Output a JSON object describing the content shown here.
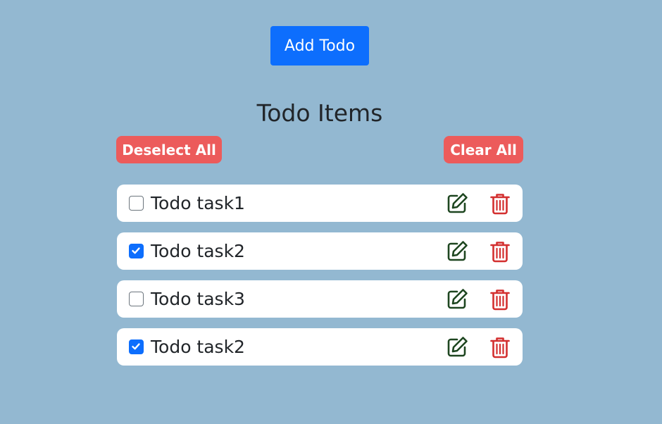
{
  "actions": {
    "add_label": "Add Todo",
    "deselect_label": "Deselect All",
    "clear_label": "Clear All"
  },
  "list": {
    "title": "Todo Items",
    "items": [
      {
        "text": "Todo task1",
        "checked": false
      },
      {
        "text": "Todo task2",
        "checked": true
      },
      {
        "text": "Todo task3",
        "checked": false
      },
      {
        "text": "Todo task2",
        "checked": true
      }
    ]
  },
  "icons": {
    "edit": "edit-icon",
    "delete": "trash-icon",
    "check": "checkmark-icon"
  },
  "colors": {
    "background": "#93b8d1",
    "primary": "#0d6efd",
    "danger_button": "#ec5b5b",
    "edit_icon": "#1e4620",
    "delete_icon": "#d32f2f"
  }
}
